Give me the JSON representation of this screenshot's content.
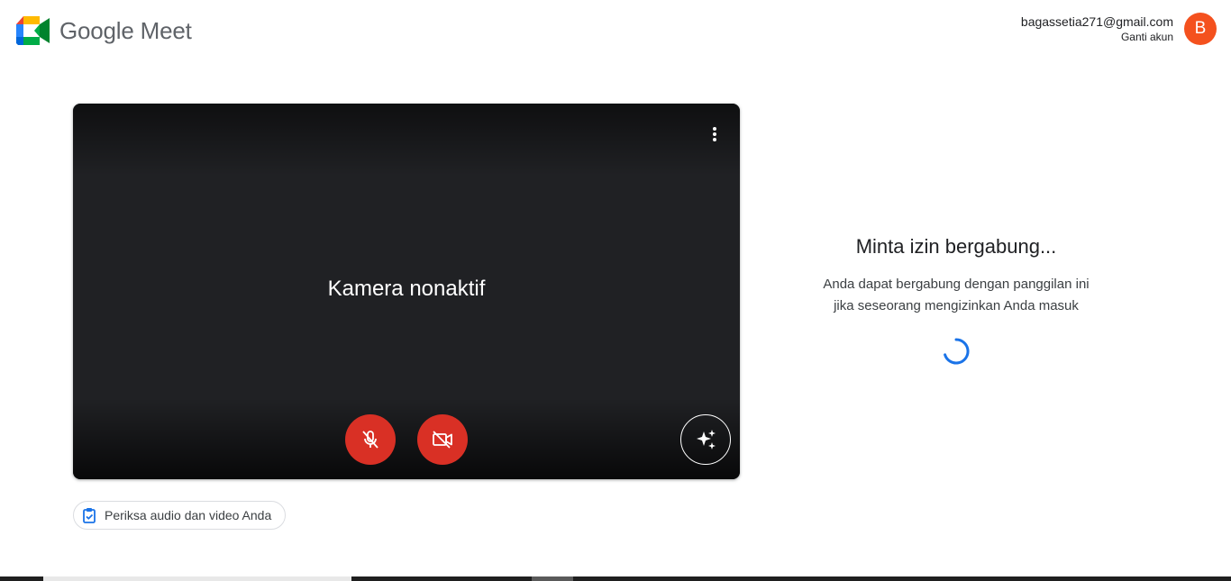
{
  "app": {
    "title": "Google Meet"
  },
  "account": {
    "email": "bagassetia271@gmail.com",
    "switch_label": "Ganti akun",
    "avatar_letter": "B",
    "avatar_color": "#f4511e"
  },
  "preview": {
    "camera_off_text": "Kamera nonaktif",
    "mic_icon": "mic-off-icon",
    "camera_icon": "videocam-off-icon",
    "effects_icon": "sparkle-icon",
    "more_icon": "more-vertical-icon",
    "button_color": "#d93025"
  },
  "check_av": {
    "label": "Periksa audio dan video Anda"
  },
  "join": {
    "title": "Minta izin bergabung...",
    "description": "Anda dapat bergabung dengan panggilan ini jika seseorang mengizinkan Anda masuk",
    "spinner_color": "#1a73e8"
  }
}
